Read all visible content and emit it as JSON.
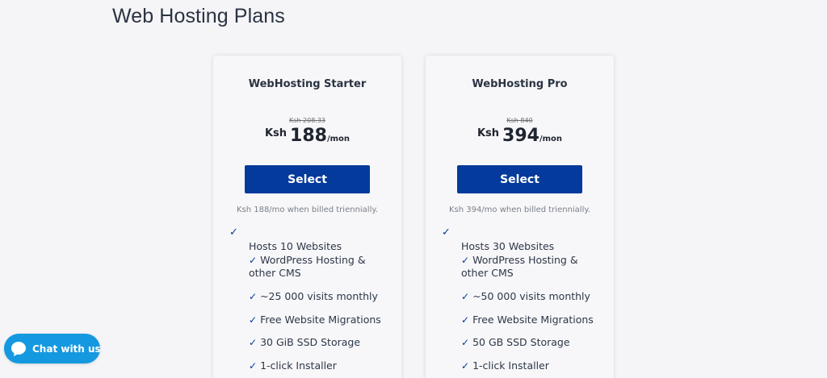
{
  "page": {
    "title": "Web Hosting Plans"
  },
  "plans": [
    {
      "name": "WebHosting Starter",
      "old_price": "Ksh 208.33",
      "currency": "Ksh",
      "price": "188",
      "period": "/mon",
      "select_label": "Select",
      "billing_note": "Ksh 188/mo when billed triennially.",
      "features": [
        "Hosts 10 Websites",
        "WordPress Hosting & other CMS",
        "~25 000 visits monthly",
        "Free Website Migrations",
        "30 GiB SSD Storage",
        "1-click Installer"
      ]
    },
    {
      "name": "WebHosting Pro",
      "old_price": "Ksh 840",
      "currency": "Ksh",
      "price": "394",
      "period": "/mon",
      "select_label": "Select",
      "billing_note": "Ksh 394/mo when billed triennially.",
      "features": [
        "Hosts 30 Websites",
        "WordPress Hosting & other CMS",
        "~50 000 visits monthly",
        "Free Website Migrations",
        "50 GB SSD Storage",
        "1-click Installer"
      ]
    }
  ],
  "check_glyph": "✓",
  "chat": {
    "label": "Chat with us",
    "icon": "chat-bubble-icon"
  },
  "colors": {
    "accent": "#033a9b",
    "chat": "#1499e0",
    "background": "#f5f5f8"
  }
}
